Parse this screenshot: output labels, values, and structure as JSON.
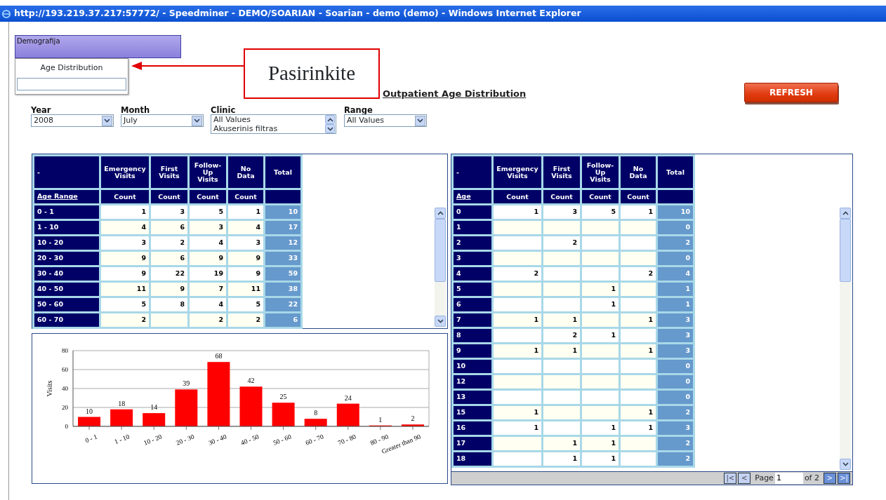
{
  "window": {
    "title": "http://193.219.37.217:57772/ - Speedminer - DEMO/SOARIAN - Soarian - demo (demo) - Windows Internet Explorer"
  },
  "menu": {
    "header": "Demografija",
    "items": [
      {
        "label": "Age Distribution"
      }
    ]
  },
  "callout": {
    "text": "Pasirinkite"
  },
  "report_title": "Outpatient Age Distribution",
  "refresh_button": "REFRESH",
  "filters": [
    {
      "kind": "select",
      "label": "Year",
      "value": "2008"
    },
    {
      "kind": "select",
      "label": "Month",
      "value": "July"
    },
    {
      "kind": "listbox",
      "label": "Clinic",
      "options": [
        "All Values",
        "Akuserinis filtras"
      ]
    },
    {
      "kind": "select",
      "label": "Range",
      "value": "All Values"
    }
  ],
  "range_table": {
    "corner": "-",
    "columns": [
      "Emergency Visits",
      "First Visits",
      "Follow-Up Visits",
      "No Data",
      "Total"
    ],
    "row_header": "Age Range",
    "measures": [
      "Count",
      "Count",
      "Count",
      "Count"
    ],
    "rows": [
      {
        "label": "0 - 1",
        "cells": [
          "1",
          "3",
          "5",
          "1"
        ],
        "total": "10"
      },
      {
        "label": "1 - 10",
        "cells": [
          "4",
          "6",
          "3",
          "4"
        ],
        "total": "17"
      },
      {
        "label": "10 - 20",
        "cells": [
          "3",
          "2",
          "4",
          "3"
        ],
        "total": "12"
      },
      {
        "label": "20 - 30",
        "cells": [
          "9",
          "6",
          "9",
          "9"
        ],
        "total": "33"
      },
      {
        "label": "30 - 40",
        "cells": [
          "9",
          "22",
          "19",
          "9"
        ],
        "total": "59"
      },
      {
        "label": "40 - 50",
        "cells": [
          "11",
          "9",
          "7",
          "11"
        ],
        "total": "38"
      },
      {
        "label": "50 - 60",
        "cells": [
          "5",
          "8",
          "4",
          "5"
        ],
        "total": "22"
      },
      {
        "label": "60 - 70",
        "cells": [
          "2",
          null,
          "2",
          "2"
        ],
        "total": "6"
      }
    ]
  },
  "chart": {
    "chart_data": {
      "type": "bar",
      "ylabel": "Visits",
      "categories": [
        "0 - 1",
        "1 - 10",
        "10 - 20",
        "20 - 30",
        "30 - 40",
        "40 - 50",
        "50 - 60",
        "60 - 70",
        "70 - 80",
        "80 - 90",
        "Greater than 90"
      ],
      "series": [
        {
          "color": "#ff0000",
          "values": [
            10,
            18,
            14,
            39,
            68,
            42,
            25,
            8,
            24,
            1,
            2
          ]
        }
      ],
      "ylim": [
        0,
        80
      ],
      "yticks": [
        0,
        20,
        40,
        60,
        80
      ],
      "grid": true,
      "data_labels": true
    }
  },
  "age_table": {
    "corner": "-",
    "columns": [
      "Emergency Visits",
      "First Visits",
      "Follow-Up Visits",
      "No Data",
      "Total"
    ],
    "row_header": "Age",
    "measures": [
      "Count",
      "Count",
      "Count",
      "Count"
    ],
    "rows": [
      {
        "label": "0",
        "cells": [
          "1",
          "3",
          "5",
          "1"
        ],
        "total": "10"
      },
      {
        "label": "1",
        "cells": [
          null,
          null,
          null,
          null
        ],
        "total": "0"
      },
      {
        "label": "2",
        "cells": [
          null,
          "2",
          null,
          null
        ],
        "total": "2"
      },
      {
        "label": "3",
        "cells": [
          null,
          null,
          null,
          null
        ],
        "total": "0"
      },
      {
        "label": "4",
        "cells": [
          "2",
          null,
          null,
          "2"
        ],
        "total": "4"
      },
      {
        "label": "5",
        "cells": [
          null,
          null,
          "1",
          null
        ],
        "total": "1"
      },
      {
        "label": "6",
        "cells": [
          null,
          null,
          "1",
          null
        ],
        "total": "1"
      },
      {
        "label": "7",
        "cells": [
          "1",
          "1",
          null,
          "1"
        ],
        "total": "3"
      },
      {
        "label": "8",
        "cells": [
          null,
          "2",
          "1",
          null
        ],
        "total": "3"
      },
      {
        "label": "9",
        "cells": [
          "1",
          "1",
          null,
          "1"
        ],
        "total": "3"
      },
      {
        "label": "10",
        "cells": [
          null,
          null,
          null,
          null
        ],
        "total": "0"
      },
      {
        "label": "12",
        "cells": [
          null,
          null,
          null,
          null
        ],
        "total": "0"
      },
      {
        "label": "13",
        "cells": [
          null,
          null,
          null,
          null
        ],
        "total": "0"
      },
      {
        "label": "15",
        "cells": [
          "1",
          null,
          null,
          "1"
        ],
        "total": "2"
      },
      {
        "label": "16",
        "cells": [
          "1",
          null,
          "1",
          "1"
        ],
        "total": "3"
      },
      {
        "label": "17",
        "cells": [
          null,
          "1",
          "1",
          null
        ],
        "total": "2"
      },
      {
        "label": "18",
        "cells": [
          null,
          "1",
          "1",
          null
        ],
        "total": "2"
      }
    ]
  },
  "pager": {
    "buttons_before": [
      {
        "label": "|<",
        "disabled": true
      },
      {
        "label": "<",
        "disabled": true
      }
    ],
    "page_label": "Page",
    "page_value": "1",
    "of_label": "of 2",
    "buttons_after": [
      {
        "label": ">",
        "disabled": false
      },
      {
        "label": ">|",
        "disabled": false
      }
    ]
  }
}
